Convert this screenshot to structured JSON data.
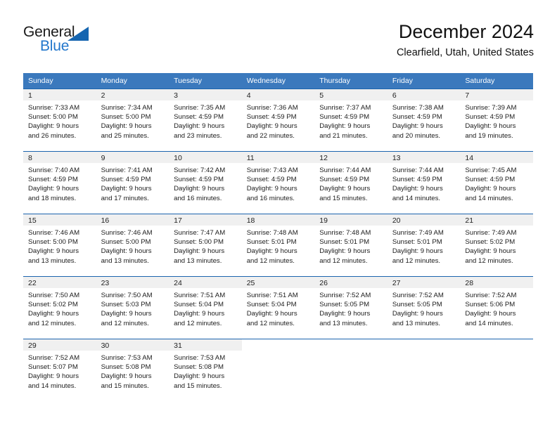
{
  "brand": {
    "name_part1": "General",
    "name_part2": "Blue",
    "colors": {
      "general_text": "#1a1a1a",
      "blue_text": "#2277cc",
      "triangle": "#1565b0"
    }
  },
  "header": {
    "title": "December 2024",
    "subtitle": "Clearfield, Utah, United States"
  },
  "theme": {
    "header_blue": "#3b79bd",
    "row_divider_blue": "#1b64ae",
    "daynum_band_bg": "#f0f0f0"
  },
  "weekdays": [
    "Sunday",
    "Monday",
    "Tuesday",
    "Wednesday",
    "Thursday",
    "Friday",
    "Saturday"
  ],
  "weeks": [
    [
      {
        "day": "1",
        "sunrise": "Sunrise: 7:33 AM",
        "sunset": "Sunset: 5:00 PM",
        "daylight_1": "Daylight: 9 hours",
        "daylight_2": "and 26 minutes."
      },
      {
        "day": "2",
        "sunrise": "Sunrise: 7:34 AM",
        "sunset": "Sunset: 5:00 PM",
        "daylight_1": "Daylight: 9 hours",
        "daylight_2": "and 25 minutes."
      },
      {
        "day": "3",
        "sunrise": "Sunrise: 7:35 AM",
        "sunset": "Sunset: 4:59 PM",
        "daylight_1": "Daylight: 9 hours",
        "daylight_2": "and 23 minutes."
      },
      {
        "day": "4",
        "sunrise": "Sunrise: 7:36 AM",
        "sunset": "Sunset: 4:59 PM",
        "daylight_1": "Daylight: 9 hours",
        "daylight_2": "and 22 minutes."
      },
      {
        "day": "5",
        "sunrise": "Sunrise: 7:37 AM",
        "sunset": "Sunset: 4:59 PM",
        "daylight_1": "Daylight: 9 hours",
        "daylight_2": "and 21 minutes."
      },
      {
        "day": "6",
        "sunrise": "Sunrise: 7:38 AM",
        "sunset": "Sunset: 4:59 PM",
        "daylight_1": "Daylight: 9 hours",
        "daylight_2": "and 20 minutes."
      },
      {
        "day": "7",
        "sunrise": "Sunrise: 7:39 AM",
        "sunset": "Sunset: 4:59 PM",
        "daylight_1": "Daylight: 9 hours",
        "daylight_2": "and 19 minutes."
      }
    ],
    [
      {
        "day": "8",
        "sunrise": "Sunrise: 7:40 AM",
        "sunset": "Sunset: 4:59 PM",
        "daylight_1": "Daylight: 9 hours",
        "daylight_2": "and 18 minutes."
      },
      {
        "day": "9",
        "sunrise": "Sunrise: 7:41 AM",
        "sunset": "Sunset: 4:59 PM",
        "daylight_1": "Daylight: 9 hours",
        "daylight_2": "and 17 minutes."
      },
      {
        "day": "10",
        "sunrise": "Sunrise: 7:42 AM",
        "sunset": "Sunset: 4:59 PM",
        "daylight_1": "Daylight: 9 hours",
        "daylight_2": "and 16 minutes."
      },
      {
        "day": "11",
        "sunrise": "Sunrise: 7:43 AM",
        "sunset": "Sunset: 4:59 PM",
        "daylight_1": "Daylight: 9 hours",
        "daylight_2": "and 16 minutes."
      },
      {
        "day": "12",
        "sunrise": "Sunrise: 7:44 AM",
        "sunset": "Sunset: 4:59 PM",
        "daylight_1": "Daylight: 9 hours",
        "daylight_2": "and 15 minutes."
      },
      {
        "day": "13",
        "sunrise": "Sunrise: 7:44 AM",
        "sunset": "Sunset: 4:59 PM",
        "daylight_1": "Daylight: 9 hours",
        "daylight_2": "and 14 minutes."
      },
      {
        "day": "14",
        "sunrise": "Sunrise: 7:45 AM",
        "sunset": "Sunset: 4:59 PM",
        "daylight_1": "Daylight: 9 hours",
        "daylight_2": "and 14 minutes."
      }
    ],
    [
      {
        "day": "15",
        "sunrise": "Sunrise: 7:46 AM",
        "sunset": "Sunset: 5:00 PM",
        "daylight_1": "Daylight: 9 hours",
        "daylight_2": "and 13 minutes."
      },
      {
        "day": "16",
        "sunrise": "Sunrise: 7:46 AM",
        "sunset": "Sunset: 5:00 PM",
        "daylight_1": "Daylight: 9 hours",
        "daylight_2": "and 13 minutes."
      },
      {
        "day": "17",
        "sunrise": "Sunrise: 7:47 AM",
        "sunset": "Sunset: 5:00 PM",
        "daylight_1": "Daylight: 9 hours",
        "daylight_2": "and 13 minutes."
      },
      {
        "day": "18",
        "sunrise": "Sunrise: 7:48 AM",
        "sunset": "Sunset: 5:01 PM",
        "daylight_1": "Daylight: 9 hours",
        "daylight_2": "and 12 minutes."
      },
      {
        "day": "19",
        "sunrise": "Sunrise: 7:48 AM",
        "sunset": "Sunset: 5:01 PM",
        "daylight_1": "Daylight: 9 hours",
        "daylight_2": "and 12 minutes."
      },
      {
        "day": "20",
        "sunrise": "Sunrise: 7:49 AM",
        "sunset": "Sunset: 5:01 PM",
        "daylight_1": "Daylight: 9 hours",
        "daylight_2": "and 12 minutes."
      },
      {
        "day": "21",
        "sunrise": "Sunrise: 7:49 AM",
        "sunset": "Sunset: 5:02 PM",
        "daylight_1": "Daylight: 9 hours",
        "daylight_2": "and 12 minutes."
      }
    ],
    [
      {
        "day": "22",
        "sunrise": "Sunrise: 7:50 AM",
        "sunset": "Sunset: 5:02 PM",
        "daylight_1": "Daylight: 9 hours",
        "daylight_2": "and 12 minutes."
      },
      {
        "day": "23",
        "sunrise": "Sunrise: 7:50 AM",
        "sunset": "Sunset: 5:03 PM",
        "daylight_1": "Daylight: 9 hours",
        "daylight_2": "and 12 minutes."
      },
      {
        "day": "24",
        "sunrise": "Sunrise: 7:51 AM",
        "sunset": "Sunset: 5:04 PM",
        "daylight_1": "Daylight: 9 hours",
        "daylight_2": "and 12 minutes."
      },
      {
        "day": "25",
        "sunrise": "Sunrise: 7:51 AM",
        "sunset": "Sunset: 5:04 PM",
        "daylight_1": "Daylight: 9 hours",
        "daylight_2": "and 12 minutes."
      },
      {
        "day": "26",
        "sunrise": "Sunrise: 7:52 AM",
        "sunset": "Sunset: 5:05 PM",
        "daylight_1": "Daylight: 9 hours",
        "daylight_2": "and 13 minutes."
      },
      {
        "day": "27",
        "sunrise": "Sunrise: 7:52 AM",
        "sunset": "Sunset: 5:05 PM",
        "daylight_1": "Daylight: 9 hours",
        "daylight_2": "and 13 minutes."
      },
      {
        "day": "28",
        "sunrise": "Sunrise: 7:52 AM",
        "sunset": "Sunset: 5:06 PM",
        "daylight_1": "Daylight: 9 hours",
        "daylight_2": "and 14 minutes."
      }
    ],
    [
      {
        "day": "29",
        "sunrise": "Sunrise: 7:52 AM",
        "sunset": "Sunset: 5:07 PM",
        "daylight_1": "Daylight: 9 hours",
        "daylight_2": "and 14 minutes."
      },
      {
        "day": "30",
        "sunrise": "Sunrise: 7:53 AM",
        "sunset": "Sunset: 5:08 PM",
        "daylight_1": "Daylight: 9 hours",
        "daylight_2": "and 15 minutes."
      },
      {
        "day": "31",
        "sunrise": "Sunrise: 7:53 AM",
        "sunset": "Sunset: 5:08 PM",
        "daylight_1": "Daylight: 9 hours",
        "daylight_2": "and 15 minutes."
      },
      {
        "day": "",
        "sunrise": "",
        "sunset": "",
        "daylight_1": "",
        "daylight_2": ""
      },
      {
        "day": "",
        "sunrise": "",
        "sunset": "",
        "daylight_1": "",
        "daylight_2": ""
      },
      {
        "day": "",
        "sunrise": "",
        "sunset": "",
        "daylight_1": "",
        "daylight_2": ""
      },
      {
        "day": "",
        "sunrise": "",
        "sunset": "",
        "daylight_1": "",
        "daylight_2": ""
      }
    ]
  ]
}
